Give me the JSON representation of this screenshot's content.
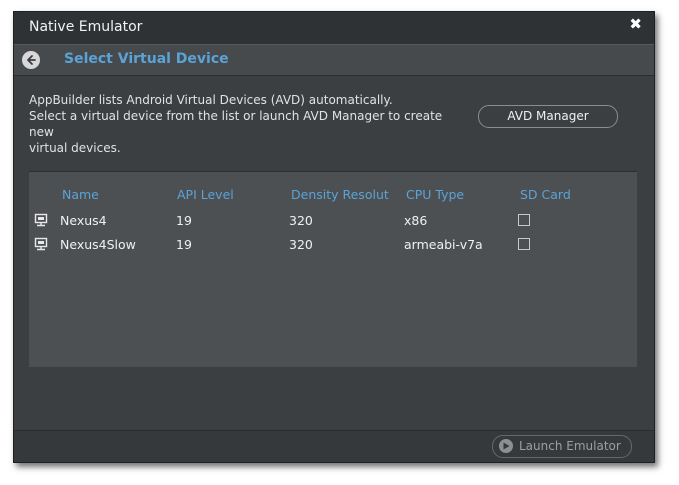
{
  "window": {
    "title": "Native Emulator",
    "close_glyph": "✖"
  },
  "subheader": {
    "back_icon": "back-arrow-icon",
    "title": "Select Virtual Device"
  },
  "description": {
    "line1": "AppBuilder lists Android Virtual Devices (AVD) automatically.",
    "line2": "Select a virtual device from the list or launch AVD Manager to create new",
    "line3": "virtual devices."
  },
  "avd_manager_label": "AVD Manager",
  "table": {
    "headers": {
      "name": "Name",
      "api": "API Level",
      "density": "Density Resolut",
      "cpu": "CPU Type",
      "sd": "SD Card"
    },
    "rows": [
      {
        "icon": "monitor-icon",
        "name": "Nexus4",
        "api": "19",
        "density": "320",
        "cpu": "x86",
        "sd_card": false
      },
      {
        "icon": "monitor-icon",
        "name": "Nexus4Slow",
        "api": "19",
        "density": "320",
        "cpu": "armeabi-v7a",
        "sd_card": false
      }
    ]
  },
  "footer": {
    "launch_label": "Launch Emulator",
    "launch_icon": "play-icon",
    "launch_enabled": false
  },
  "colors": {
    "accent": "#5aa3d6",
    "window_bg": "#3c3f42",
    "panel_bg": "#4d5053"
  }
}
